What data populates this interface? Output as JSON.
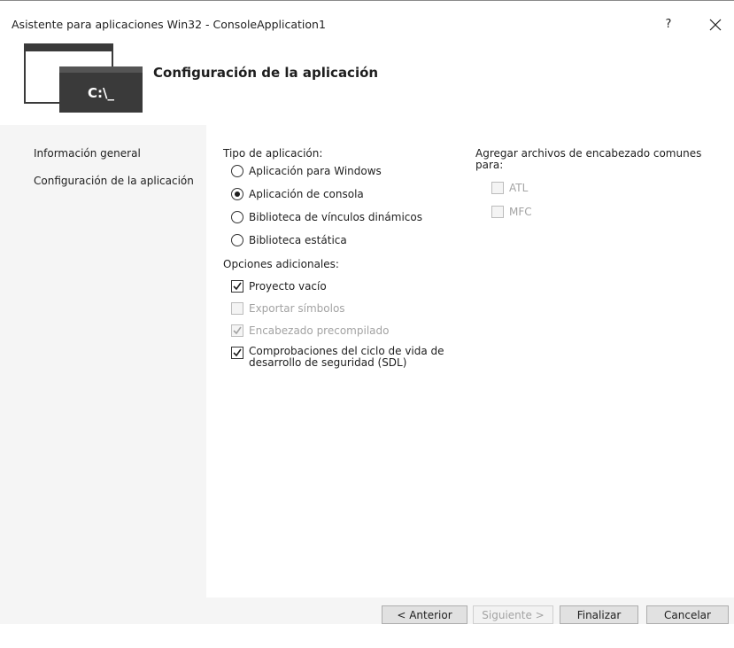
{
  "window": {
    "title": "Asistente para aplicaciones Win32 - ConsoleApplication1",
    "help_label": "?",
    "close_label": "✕"
  },
  "header": {
    "title": "Configuración de la aplicación",
    "logo_text": "C:\\_",
    "logo_controls": "_ ▫ ×"
  },
  "sidebar": {
    "items": [
      {
        "label": "Información general"
      },
      {
        "label": "Configuración de la aplicación"
      }
    ]
  },
  "app_type": {
    "heading": "Tipo de aplicación:",
    "options": [
      {
        "label": "Aplicación para Windows",
        "selected": false
      },
      {
        "label": "Aplicación de consola",
        "selected": true
      },
      {
        "label": "Biblioteca de vínculos dinámicos",
        "selected": false
      },
      {
        "label": "Biblioteca estática",
        "selected": false
      }
    ]
  },
  "additional": {
    "heading": "Opciones adicionales:",
    "options": [
      {
        "label": "Proyecto vacío",
        "checked": true,
        "enabled": true
      },
      {
        "label": "Exportar símbolos",
        "checked": false,
        "enabled": false
      },
      {
        "label": "Encabezado precompilado",
        "checked": true,
        "enabled": false
      },
      {
        "label": "Comprobaciones del ciclo de vida de",
        "label2": "desarrollo de seguridad (SDL)",
        "checked": true,
        "enabled": true
      }
    ]
  },
  "headers": {
    "heading1": "Agregar archivos de encabezado comunes",
    "heading2": "para:",
    "options": [
      {
        "label": "ATL",
        "checked": false,
        "enabled": false
      },
      {
        "label": "MFC",
        "checked": false,
        "enabled": false
      }
    ]
  },
  "buttons": {
    "back": "< Anterior",
    "next": "Siguiente >",
    "finish": "Finalizar",
    "cancel": "Cancelar"
  }
}
